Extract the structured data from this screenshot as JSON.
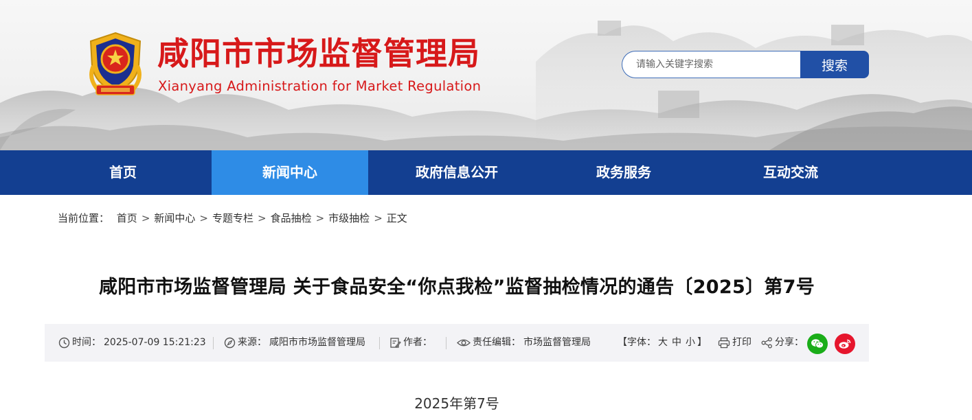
{
  "header": {
    "title": "咸阳市市场监督管理局",
    "subtitle": "Xianyang Administration for Market Regulation",
    "search_placeholder": "请输入关键字搜索",
    "search_button": "搜索",
    "brand_color": "#d7191a",
    "emblem_icon": "police-emblem-icon"
  },
  "nav": {
    "items": [
      {
        "label": "首页",
        "active": false
      },
      {
        "label": "新闻中心",
        "active": true
      },
      {
        "label": "政府信息公开",
        "active": false
      },
      {
        "label": "政务服务",
        "active": false
      },
      {
        "label": "互动交流",
        "active": false
      }
    ],
    "bg_color": "#133f91",
    "active_color": "#2e8ce6"
  },
  "breadcrumb": {
    "prefix": "当前位置：",
    "items": [
      "首页",
      "新闻中心",
      "专题专栏",
      "食品抽检",
      "市级抽检",
      "正文"
    ],
    "separator": ">"
  },
  "article": {
    "title": "咸阳市市场监督管理局 关于食品安全“你点我检”监督抽检情况的通告〔2025〕第7号",
    "doc_number": "2025年第7号",
    "meta": {
      "time_label": "时间：",
      "time_value": "2025-07-09 15:21:23",
      "source_label": "来源：",
      "source_value": "咸阳市市场监督管理局",
      "author_label": "作者：",
      "author_value": "",
      "editor_label": "责任编辑：",
      "editor_value": "市场监督管理局",
      "font_label_open": "【字体：",
      "font_large": "大",
      "font_medium": "中",
      "font_small": "小",
      "font_label_close": "】",
      "print_label": "打印",
      "share_label": "分享："
    },
    "share_colors": {
      "wechat": "#1aad19",
      "weibo": "#e6162d"
    }
  }
}
